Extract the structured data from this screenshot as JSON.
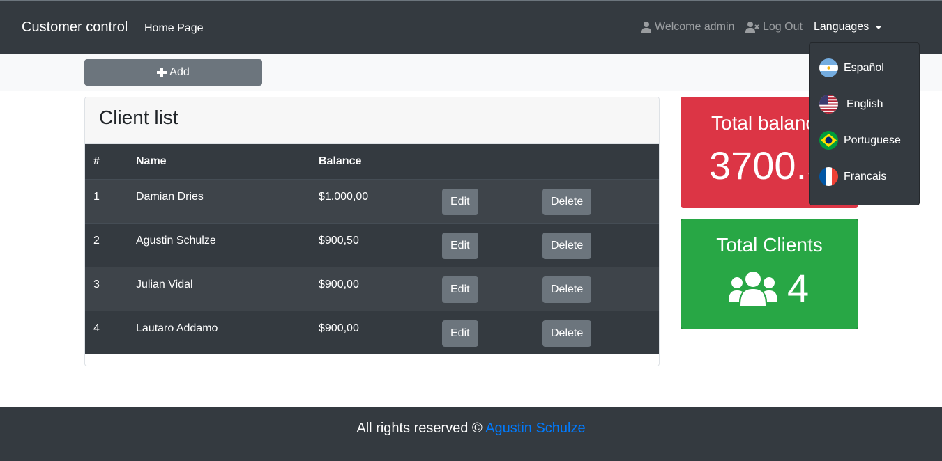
{
  "navbar": {
    "brand": "Customer control",
    "home": "Home Page",
    "welcome": "Welcome admin",
    "logout": "Log Out",
    "languages": "Languages"
  },
  "toolbar": {
    "add_label": "Add"
  },
  "client_list": {
    "title": "Client list",
    "columns": [
      "#",
      "Name",
      "Balance"
    ],
    "rows": [
      {
        "id": "1",
        "name": "Damian Dries",
        "balance": "$1.000,00",
        "edit": "Edit",
        "delete": "Delete"
      },
      {
        "id": "2",
        "name": "Agustin Schulze",
        "balance": "$900,50",
        "edit": "Edit",
        "delete": "Delete"
      },
      {
        "id": "3",
        "name": "Julian Vidal",
        "balance": "$900,00",
        "edit": "Edit",
        "delete": "Delete"
      },
      {
        "id": "4",
        "name": "Lautaro Addamo",
        "balance": "$900,00",
        "edit": "Edit",
        "delete": "Delete"
      }
    ]
  },
  "stats": {
    "balance_title": "Total balance",
    "balance_value": "3700.50",
    "clients_title": "Total Clients",
    "clients_value": "4"
  },
  "language_menu": {
    "items": [
      {
        "label": "Español",
        "flag": "argentina-flag-icon"
      },
      {
        "label": "English",
        "flag": "usa-flag-icon"
      },
      {
        "label": "Portuguese",
        "flag": "brazil-flag-icon"
      },
      {
        "label": "Francais",
        "flag": "france-flag-icon"
      }
    ]
  },
  "footer": {
    "text": "All rights reserved ©",
    "author": "Agustin Schulze"
  },
  "colors": {
    "navbar": "#343a40",
    "danger": "#dc3545",
    "success": "#28a745",
    "secondary": "#6c757d",
    "link": "#007bff"
  }
}
